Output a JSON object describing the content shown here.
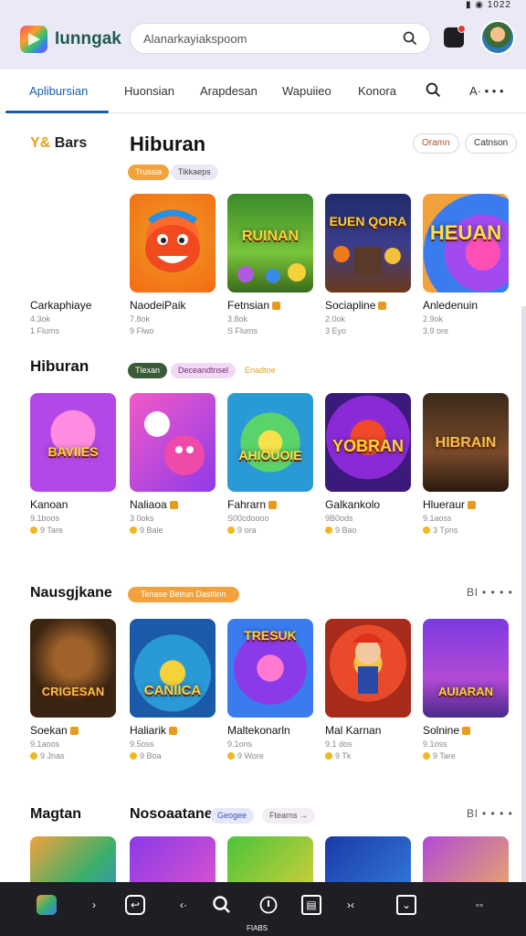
{
  "status": {
    "time": "1022"
  },
  "header": {
    "brand": "Iunngak",
    "search_placeholder": "Alanarkayiakspoom"
  },
  "tabs": [
    "Aplibursian",
    "Huonsian",
    "Arapdesan",
    "Wapuiieo",
    "Konora"
  ],
  "tabs_more": "A· • • •",
  "sidebar": {
    "title": "Bars",
    "title_mark": "Y&"
  },
  "sections": [
    {
      "title": "Hiburan",
      "chips": [
        {
          "label": "Trussia",
          "color": "#f2a23c"
        },
        {
          "label": "Tikkaeps",
          "color": "#ece9f6",
          "text": "#444"
        }
      ],
      "actions": [
        "Oramn",
        "Catnson"
      ],
      "cards": [
        {
          "name": "Carkaphiaye",
          "m1": "4.3ok",
          "m2": "1 Flums",
          "badge": false
        },
        {
          "name": "NaodeiPaik",
          "m1": "7.8ok",
          "m2": "9 Flwo",
          "badge": false
        },
        {
          "name": "Fetnsian",
          "m1": "3.8ok",
          "m2": "S Flums",
          "badge": true
        },
        {
          "name": "Sociapline",
          "m1": "2.0ok",
          "m2": "3 Eyo",
          "badge": true
        },
        {
          "name": "Anledenuin",
          "m1": "2.9ok",
          "m2": "3.9 ore",
          "badge": false
        }
      ]
    },
    {
      "title": "Hiburan",
      "chips": [
        {
          "label": "Tlexan",
          "color": "#3a5a3a"
        },
        {
          "label": "Deceandtnsel",
          "color": "#f1d9f4",
          "text": "#7a2a7a"
        },
        {
          "label": "Enadtoe",
          "color": "#fff",
          "text": "#e0a420"
        }
      ],
      "cards": [
        {
          "name": "Kanoan",
          "m1": "9.1boos",
          "m2": "9 Tare",
          "badge": false
        },
        {
          "name": "Naliaoa",
          "m1": "3 0oks",
          "m2": "9 Bale",
          "badge": true
        },
        {
          "name": "Fahrarn",
          "m1": "S00cdoooo",
          "m2": "9 ora",
          "badge": true
        },
        {
          "name": "Galkankolo",
          "m1": "9B0ods",
          "m2": "9 Bao",
          "badge": false
        },
        {
          "name": "Hlueraur",
          "m1": "9.1aoss",
          "m2": "3 Tpns",
          "badge": true
        }
      ]
    },
    {
      "title": "Nausgjkane",
      "chips": [
        {
          "label": "Tenase Betrun Dasttinn",
          "color": "#f2a23c"
        }
      ],
      "more": "Bl • • • •",
      "cards": [
        {
          "name": "Soekan",
          "m1": "9.1aoos",
          "m2": "9 Jnas",
          "badge": true
        },
        {
          "name": "Haliarik",
          "m1": "9.5oss",
          "m2": "9 Boa",
          "badge": true
        },
        {
          "name": "Maltekonarln",
          "m1": "9.1ons",
          "m2": "9 Wore",
          "badge": false
        },
        {
          "name": "Mal Karnan",
          "m1": "9.1 dos",
          "m2": "9 Tk",
          "badge": false
        },
        {
          "name": "Solnine",
          "m1": "9.1oss",
          "m2": "9 Tare",
          "badge": true
        }
      ]
    },
    {
      "title": "Magtan",
      "subtitle": "Nosoaatane",
      "chips": [
        {
          "label": "Geogee",
          "color": "#e5e8fb",
          "text": "#3b4fb0"
        },
        {
          "label": "Ftearns →",
          "color": "#f3eef4",
          "text": "#555"
        }
      ],
      "more": "Bl • • • •"
    }
  ],
  "bottombar": {
    "label": "FIABS"
  },
  "colors": {
    "accent": "#1a5ea8",
    "header_bg": "#ece9f6",
    "bottom_bg": "#1f1e24"
  }
}
